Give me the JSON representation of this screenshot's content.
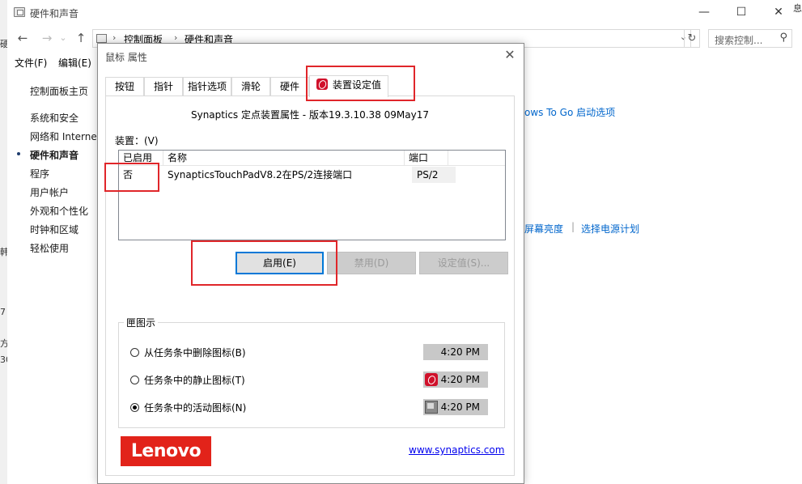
{
  "window": {
    "title": "硬件和声音",
    "minimize": "—",
    "maximize": "☐",
    "close": "✕"
  },
  "nav": {
    "back": "←",
    "forward": "→",
    "dropdown": "⌄",
    "up": "↑",
    "breadcrumb": [
      "控制面板",
      "硬件和声音"
    ],
    "crumb_sep": "›",
    "address_dropdown": "⌄",
    "refresh": "↻",
    "search_placeholder": "搜索控制...",
    "search_icon": "⚲"
  },
  "menubar": {
    "file": "文件(F)",
    "edit": "编辑(E)"
  },
  "sidebar": {
    "home": "控制面板主页",
    "items": [
      "系统和安全",
      "网络和 Internet",
      "硬件和声音",
      "程序",
      "用户帐户",
      "外观和个性化",
      "时钟和区域",
      "轻松使用"
    ],
    "active_index": 2
  },
  "content": {
    "link1": "ows To Go 启动选项",
    "link2": "屏幕亮度",
    "link3": "选择电源计划",
    "sep": "|"
  },
  "left_edge_fragments": [
    "硬",
    "韩",
    "7",
    "方",
    "30"
  ],
  "right_edge_fragment": "息",
  "dialog": {
    "title": "鼠标 属性",
    "close": "✕",
    "tabs": [
      "按钮",
      "指针",
      "指针选项",
      "滑轮",
      "硬件",
      "装置设定值"
    ],
    "active_tab": "装置设定值",
    "version": "Synaptics 定点装置属性 - 版本19.3.10.38 09May17",
    "device_label": "装置：(V)",
    "list": {
      "columns": [
        "已启用",
        "名称",
        "端口"
      ],
      "rows": [
        {
          "enabled": "否",
          "name": "SynapticsTouchPadV8.2在PS/2连接端口",
          "port": "PS/2"
        }
      ]
    },
    "buttons": {
      "enable": "启用(E)",
      "disable": "禁用(D)",
      "settings": "设定值(S)..."
    },
    "tray_group": {
      "title": "匣图示",
      "options": [
        {
          "label": "从任务条中删除图标(B)",
          "checked": false,
          "time": "4:20 PM",
          "icon": "none"
        },
        {
          "label": "任务条中的静止图标(T)",
          "checked": false,
          "time": "4:20 PM",
          "icon": "synaptics-static-icon"
        },
        {
          "label": "任务条中的活动图标(N)",
          "checked": true,
          "time": "4:20 PM",
          "icon": "synaptics-active-icon"
        }
      ]
    },
    "brand": "Lenovo",
    "link": "www.synaptics.com"
  },
  "colors": {
    "annotation_red": "#e0262a",
    "lenovo_red": "#e2231a",
    "link_blue": "#0066cc"
  }
}
